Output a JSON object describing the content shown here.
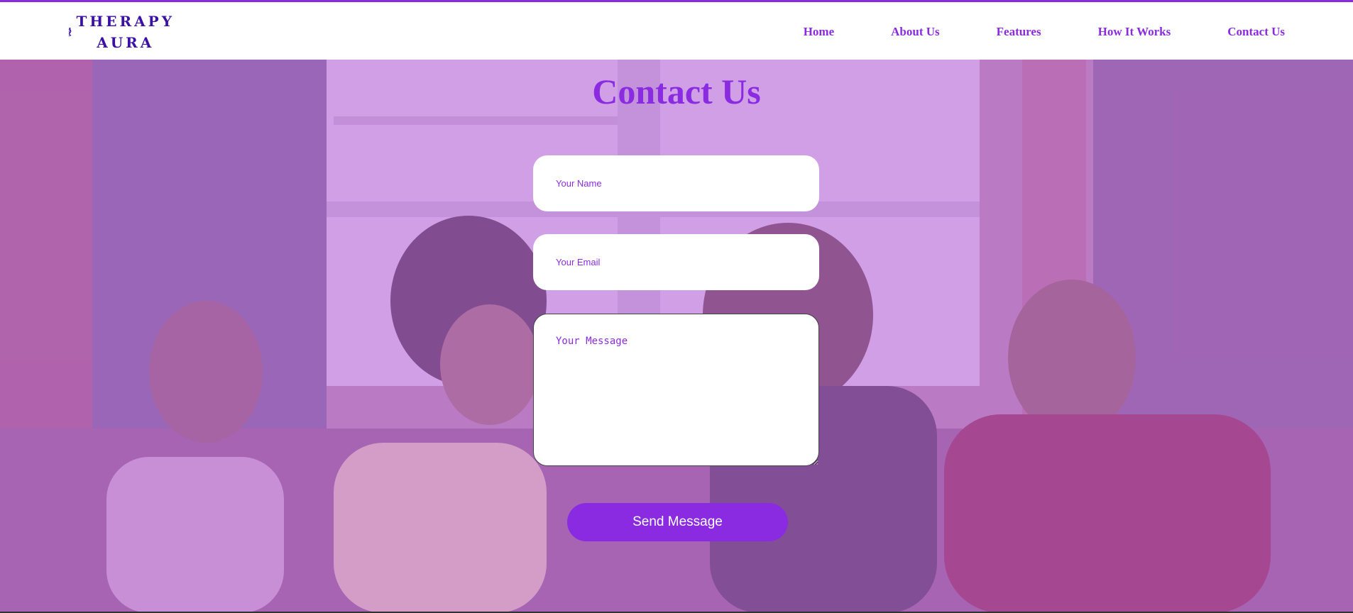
{
  "brand": {
    "name_line1": "THERAPY",
    "name_line2": "AURA",
    "logo_icon": "ribbon-stethoscope-icon",
    "color": "#3a10a6"
  },
  "nav": {
    "items": [
      {
        "label": "Home"
      },
      {
        "label": "About Us"
      },
      {
        "label": "Features"
      },
      {
        "label": "How It Works"
      },
      {
        "label": "Contact Us"
      }
    ]
  },
  "contact": {
    "title": "Contact Us",
    "name_placeholder": "Your Name",
    "email_placeholder": "Your Email",
    "message_placeholder": "Your Message",
    "submit_label": "Send Message"
  },
  "colors": {
    "accent": "#8a2be2",
    "overlay": "rgba(190, 110, 225, 0.55)",
    "background": "#ffffff"
  }
}
